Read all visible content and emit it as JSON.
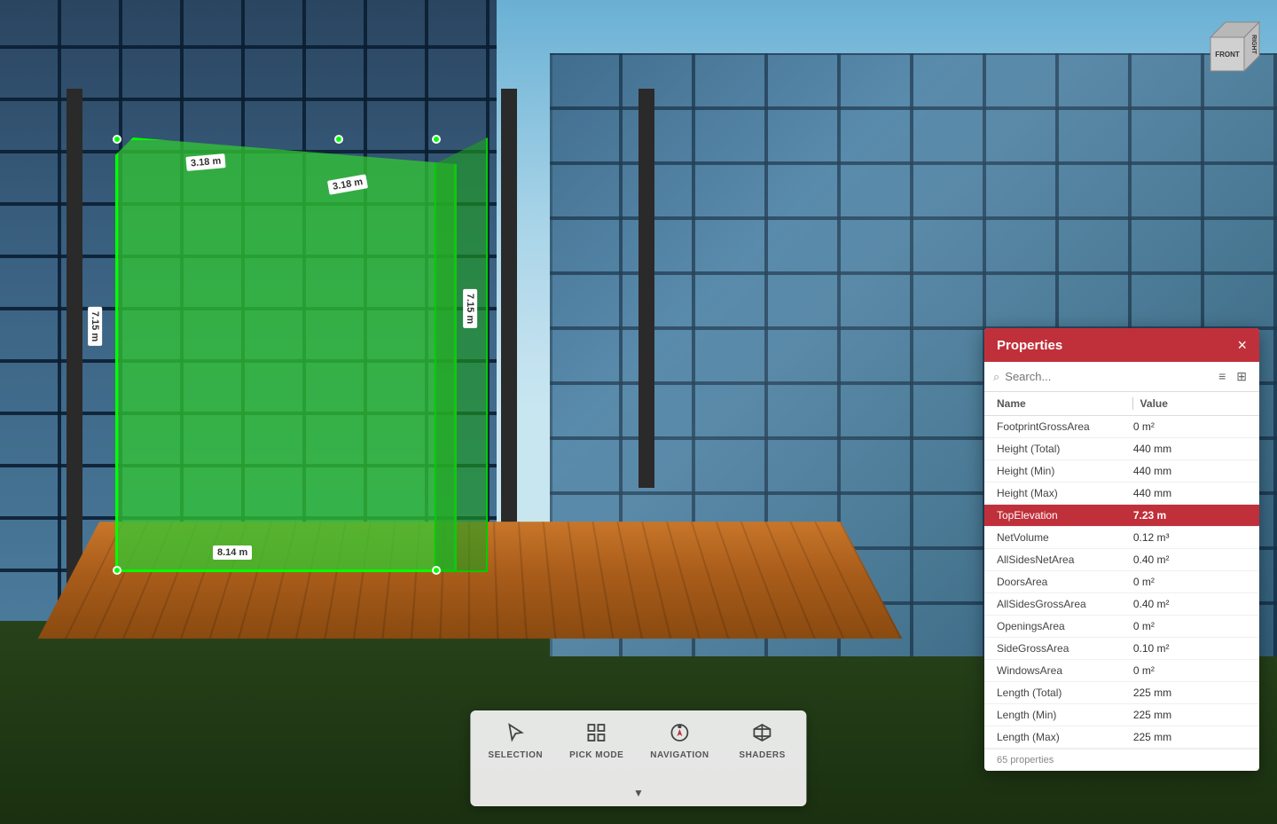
{
  "viewport": {
    "dimensions": {
      "top1": "3.18 m",
      "top2": "3.18 m",
      "left": "7.15 m",
      "right": "7.15 m",
      "bottom": "8.14 m"
    }
  },
  "viewcube": {
    "front": "FRONT",
    "right": "RIGHT"
  },
  "properties_panel": {
    "title": "Properties",
    "close_label": "×",
    "search_placeholder": "Search...",
    "columns": {
      "name": "Name",
      "value": "Value"
    },
    "rows": [
      {
        "name": "FootprintGrossArea",
        "value": "0 m²",
        "highlighted": false
      },
      {
        "name": "Height (Total)",
        "value": "440 mm",
        "highlighted": false
      },
      {
        "name": "Height (Min)",
        "value": "440 mm",
        "highlighted": false
      },
      {
        "name": "Height (Max)",
        "value": "440 mm",
        "highlighted": false
      },
      {
        "name": "TopElevation",
        "value": "7.23 m",
        "highlighted": true
      },
      {
        "name": "NetVolume",
        "value": "0.12 m³",
        "highlighted": false
      },
      {
        "name": "AllSidesNetArea",
        "value": "0.40 m²",
        "highlighted": false
      },
      {
        "name": "DoorsArea",
        "value": "0 m²",
        "highlighted": false
      },
      {
        "name": "AllSidesGrossArea",
        "value": "0.40 m²",
        "highlighted": false
      },
      {
        "name": "OpeningsArea",
        "value": "0 m²",
        "highlighted": false
      },
      {
        "name": "SideGrossArea",
        "value": "0.10 m²",
        "highlighted": false
      },
      {
        "name": "WindowsArea",
        "value": "0 m²",
        "highlighted": false
      },
      {
        "name": "Length (Total)",
        "value": "225 mm",
        "highlighted": false
      },
      {
        "name": "Length (Min)",
        "value": "225 mm",
        "highlighted": false
      },
      {
        "name": "Length (Max)",
        "value": "225 mm",
        "highlighted": false
      }
    ],
    "count_label": "65 properties"
  },
  "toolbar": {
    "buttons": [
      {
        "id": "selection",
        "label": "SELECTION",
        "icon": "cursor"
      },
      {
        "id": "pick-mode",
        "label": "PICK MODE",
        "icon": "grid"
      },
      {
        "id": "navigation",
        "label": "NAVIGATION",
        "icon": "compass"
      },
      {
        "id": "shaders",
        "label": "SHADERS",
        "icon": "cube"
      }
    ],
    "collapse_label": "▼"
  }
}
